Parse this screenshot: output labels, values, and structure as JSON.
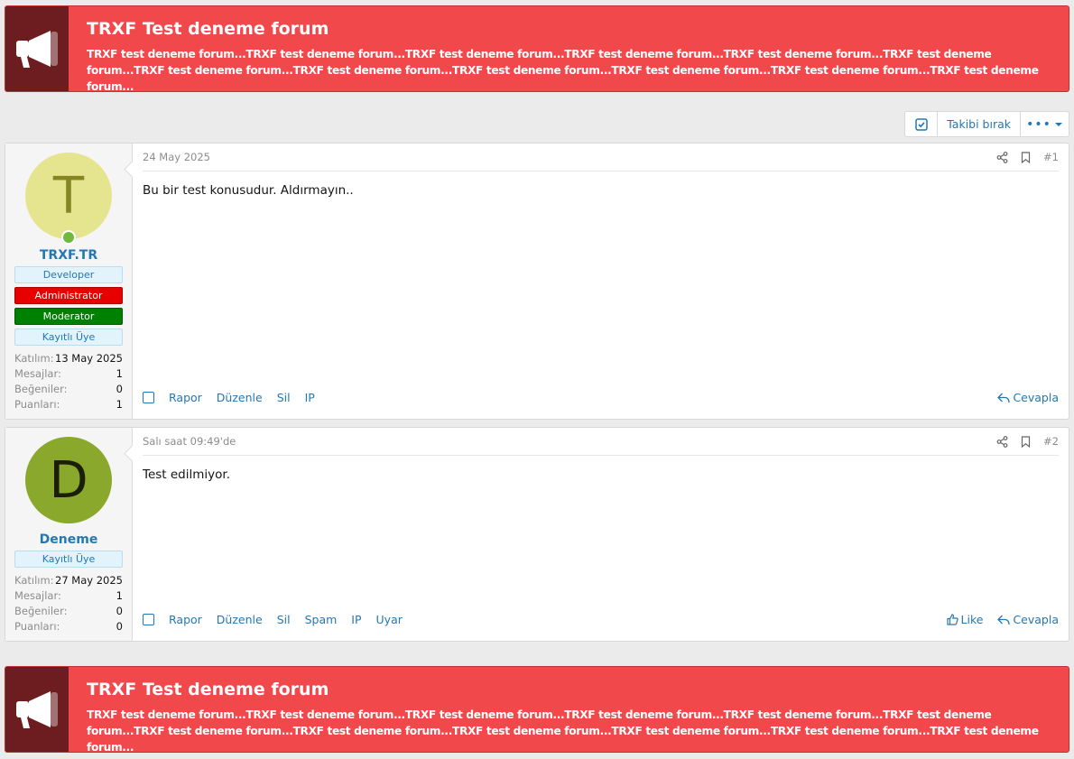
{
  "notice": {
    "title": "TRXF Test deneme forum",
    "text": "TRXF test deneme forum...TRXF test deneme forum...TRXF test deneme forum...TRXF test deneme forum...TRXF test deneme forum...TRXF test deneme forum...TRXF test deneme forum...TRXF test deneme forum...TRXF test deneme forum...TRXF test deneme forum...TRXF test deneme forum...TRXF test deneme forum..."
  },
  "thread_actions": {
    "unfollow_label": "Takibi bırak",
    "more_label": "•••"
  },
  "posts": [
    {
      "avatar_letter": "T",
      "username": "TRXF.TR",
      "banners": [
        "Developer",
        "Administrator",
        "Moderator",
        "Kayıtlı Üye"
      ],
      "stats": [
        {
          "label": "Katılım:",
          "value": "13 May 2025"
        },
        {
          "label": "Mesajlar:",
          "value": "1"
        },
        {
          "label": "Beğeniler:",
          "value": "0"
        },
        {
          "label": "Puanları:",
          "value": "1"
        }
      ],
      "date": "24 May 2025",
      "number": "#1",
      "body": "Bu bir test konusudur. Aldırmayın..",
      "actions": [
        "Rapor",
        "Düzenle",
        "Sil",
        "IP"
      ],
      "reply_label": "Cevapla"
    },
    {
      "avatar_letter": "D",
      "username": "Deneme",
      "banners": [
        "Kayıtlı Üye"
      ],
      "stats": [
        {
          "label": "Katılım:",
          "value": "27 May 2025"
        },
        {
          "label": "Mesajlar:",
          "value": "1"
        },
        {
          "label": "Beğeniler:",
          "value": "0"
        },
        {
          "label": "Puanları:",
          "value": "0"
        }
      ],
      "date": "Salı saat 09:49'de",
      "number": "#2",
      "body": "Test edilmiyor.",
      "actions": [
        "Rapor",
        "Düzenle",
        "Sil",
        "Spam",
        "IP",
        "Uyar"
      ],
      "like_label": "Like",
      "reply_label": "Cevapla"
    }
  ],
  "colors": {
    "notice_bg": "#f0484b",
    "notice_icon_bg": "#6d1d1f",
    "link": "#2577b1"
  }
}
